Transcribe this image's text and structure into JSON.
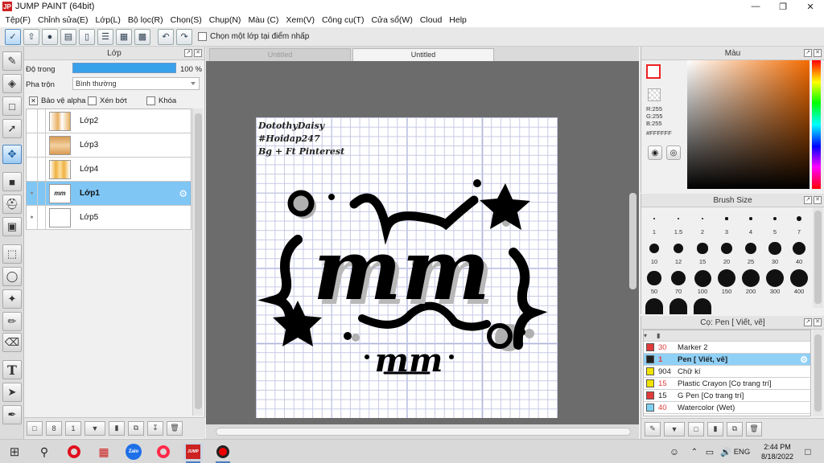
{
  "window": {
    "title": "JUMP PAINT (64bit)",
    "logo_text": "JP"
  },
  "menu": [
    "Tệp(F)",
    "Chỉnh sửa(E)",
    "Lớp(L)",
    "Bộ lọc(R)",
    "Chọn(S)",
    "Chụp(N)",
    "Màu (C)",
    "Xem(V)",
    "Công cụ(T)",
    "Cửa sổ(W)",
    "Cloud",
    "Help"
  ],
  "toolbar": {
    "checkbox_label": "Chọn một lớp tại điểm nhấp"
  },
  "layer_panel": {
    "title": "Lớp",
    "opacity_label": "Độ trong",
    "opacity_value": "100 %",
    "opacity_fraction": 1.0,
    "blend_label": "Pha trộn",
    "blend_value": "Bình thường",
    "protect_alpha": "Bảo vệ alpha",
    "clipping": "Xén bớt",
    "lock": "Khóa",
    "layers": [
      {
        "name": "Lớp2",
        "thumb": "#e8b060",
        "selected": false
      },
      {
        "name": "Lớp3",
        "thumb": "#d89a52",
        "selected": false
      },
      {
        "name": "Lớp4",
        "thumb": "#f0b040",
        "selected": false
      },
      {
        "name": "Lớp1",
        "thumb": "#ffffff",
        "selected": true
      },
      {
        "name": "Lớp5",
        "thumb": "#ffffff",
        "selected": false
      }
    ]
  },
  "canvas": {
    "tabs": [
      {
        "label": "Untitled",
        "active": false
      },
      {
        "label": "Untitled",
        "active": true
      }
    ],
    "watermark": [
      "DotothyDaisy",
      "#Hoidap247",
      "Bg + Ft Pinterest"
    ],
    "art_big_text": "mm",
    "art_small_text": "mm"
  },
  "color_panel": {
    "title": "Màu",
    "rgb": [
      "R:255",
      "G:255",
      "B:255"
    ],
    "hex": "#FFFFFF",
    "accent": "#e22222"
  },
  "brush_panel": {
    "title": "Brush Size",
    "sizes": [
      "1",
      "1.5",
      "2",
      "3",
      "4",
      "5",
      "7",
      "10",
      "12",
      "15",
      "20",
      "25",
      "30",
      "40",
      "50",
      "70",
      "100",
      "150",
      "200",
      "300",
      "400"
    ]
  },
  "tool_panel": {
    "title": "Cọ: Pen [ Viết, vẽ]",
    "items": [
      {
        "num": "30",
        "name": "Marker 2",
        "color": "#e23b3b",
        "num_color": "#e23b3b",
        "selected": false
      },
      {
        "num": "1",
        "name": "Pen [ Viết, vẽ]",
        "color": "#222222",
        "num_color": "#e23b3b",
        "selected": true
      },
      {
        "num": "904",
        "name": "Chữ kí",
        "color": "#f2e200",
        "num_color": "#222222",
        "selected": false
      },
      {
        "num": "15",
        "name": "Plastic Crayon [Cọ trang trí]",
        "color": "#f2e200",
        "num_color": "#e23b3b",
        "selected": false
      },
      {
        "num": "15",
        "name": "G Pen [Cọ trang trí]",
        "color": "#e23b3b",
        "num_color": "#222222",
        "selected": false
      },
      {
        "num": "40",
        "name": "Watercolor (Wet)",
        "color": "#7fd0f0",
        "num_color": "#e23b3b",
        "selected": false
      }
    ]
  },
  "taskbar": {
    "time": "2:44 PM",
    "date": "8/18/2022",
    "lang": "ENG",
    "apps": [
      "windows-icon",
      "search-icon",
      "opera-icon",
      "app-grid-icon",
      "zalo-icon",
      "opera-gx-icon",
      "jump-paint-icon",
      "recorder-icon"
    ],
    "zalo_label": "Zalo",
    "jp_label": "JUMP"
  }
}
